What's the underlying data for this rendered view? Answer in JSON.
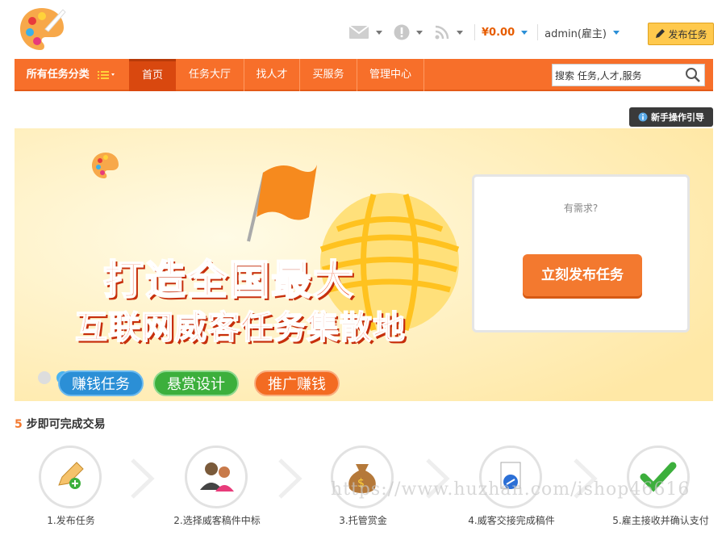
{
  "header": {
    "balance": "¥0.00",
    "user": "admin(雇主)",
    "post_task": "发布任务",
    "icons": [
      "mail-icon",
      "alert-icon",
      "rss-icon"
    ]
  },
  "nav": {
    "all_categories": "所有任务分类",
    "items": [
      "首页",
      "任务大厅",
      "找人才",
      "买服务",
      "管理中心"
    ],
    "search_value": "搜索 任务,人才,服务"
  },
  "guide": "新手操作引导",
  "banner": {
    "headline_1": "打造全国最大",
    "headline_2": "互联网威客任务集散地",
    "tags": [
      "赚钱任务",
      "悬赏设计",
      "推广赚钱"
    ],
    "demand_label": "有需求?",
    "demand_button": "立刻发布任务"
  },
  "steps": {
    "title_num": "5",
    "title_text": " 步即可完成交易",
    "items": [
      "1.发布任务",
      "2.选择威客稿件中标",
      "3.托管赏金",
      "4.威客交接完成稿件",
      "5.雇主接收并确认支付"
    ]
  },
  "watermark": "https://www.huzhan.com/ishop46616",
  "colors": {
    "primary": "#f76f2a",
    "active": "#d9480f",
    "accent": "#f3792f",
    "balance": "#e65c00"
  }
}
